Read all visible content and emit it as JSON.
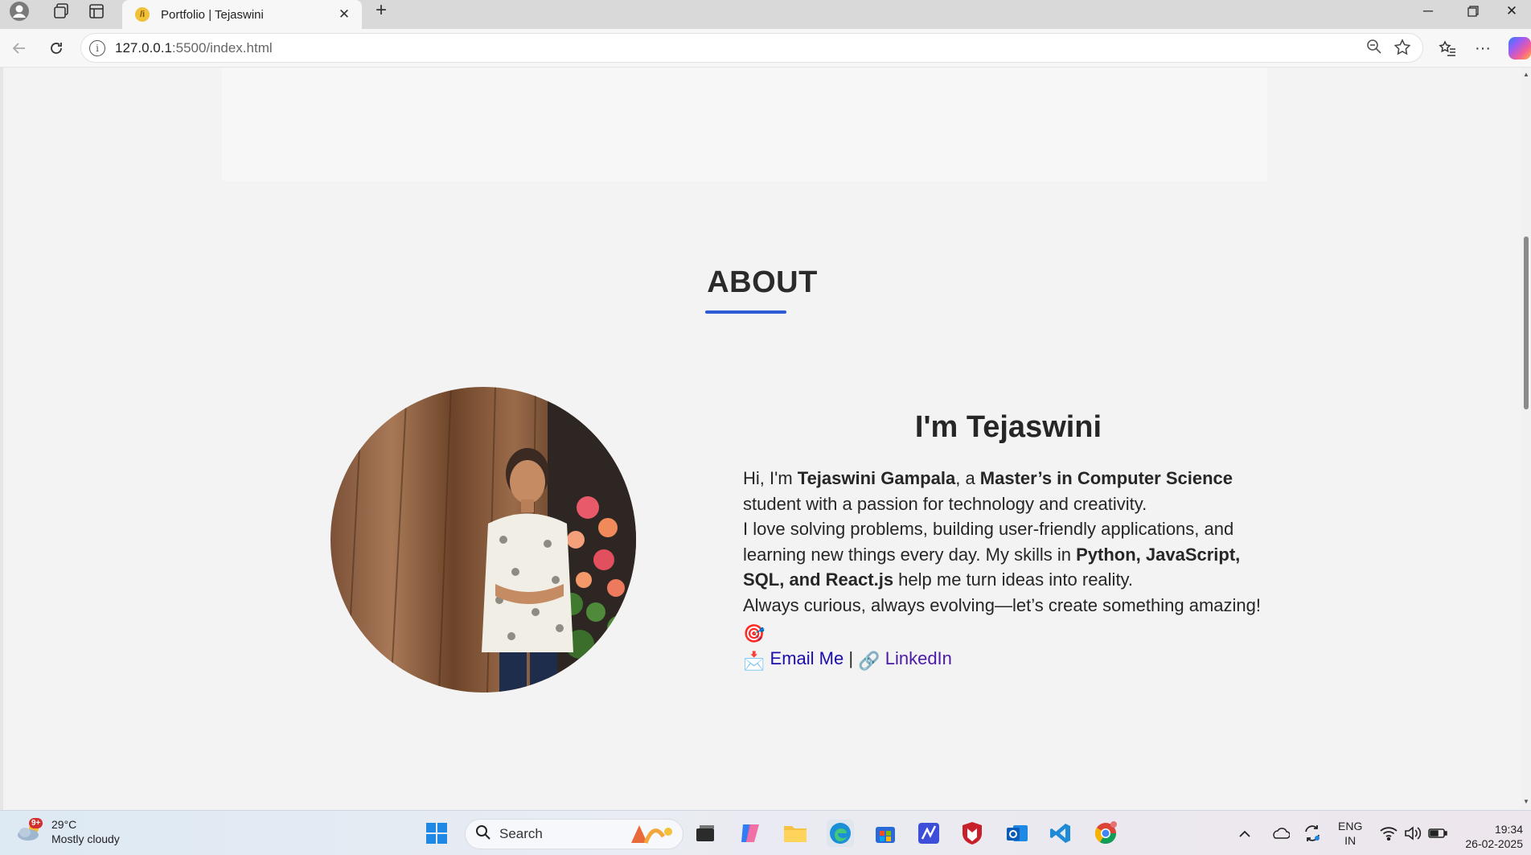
{
  "browser": {
    "tab_title": "Portfolio | Tejaswini",
    "tab_favicon": "/i",
    "url_host": "127.0.0.1",
    "url_rest": ":5500/index.html"
  },
  "page": {
    "section_heading": "ABOUT",
    "title": "I'm Tejaswini",
    "intro_prefix": "Hi, I'm ",
    "intro_name": "Tejaswini Gampala",
    "intro_mid": ", a ",
    "intro_degree": "Master’s in Computer Science",
    "intro_suffix": " student with a passion for technology and creativity.",
    "para2_prefix": "I love solving problems, building user-friendly applications, and learning new things every day. My skills in ",
    "para2_skills": "Python, JavaScript, SQL, and React.js",
    "para2_suffix": " help me turn ideas into reality.",
    "para3": "Always curious, always evolving—let’s create something amazing!",
    "para3_emoji": "🎯",
    "email_emoji": "📩",
    "email_label": "Email Me",
    "separator": "|",
    "linkedin_emoji": "🔗",
    "linkedin_label": "LinkedIn"
  },
  "taskbar": {
    "weather_badge": "9+",
    "weather_temp": "29°C",
    "weather_desc": "Mostly cloudy",
    "search_label": "Search",
    "language_line1": "ENG",
    "language_line2": "IN",
    "time": "19:34",
    "date": "26-02-2025"
  }
}
